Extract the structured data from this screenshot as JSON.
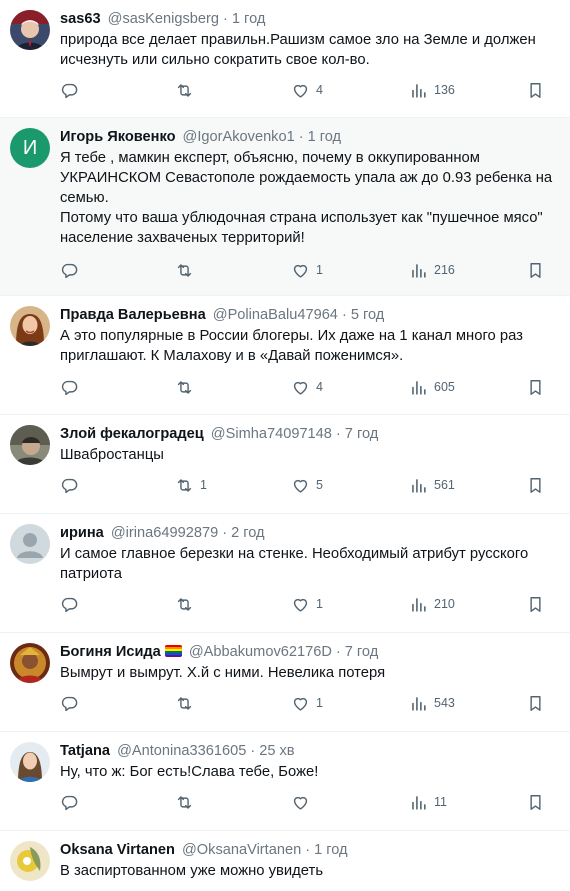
{
  "icons": {
    "reply": "reply-icon",
    "retweet": "retweet-icon",
    "like": "heart-icon",
    "views": "views-icon",
    "bookmark": "bookmark-icon"
  },
  "colors": {
    "icon": "#536471",
    "muted": "#6b7680",
    "highlight_bg": "#f7f9f9",
    "avatar_igor": "#1a9a6c"
  },
  "posts": [
    {
      "name": "sas63",
      "handle": "@sasKenigsberg",
      "time": "1 год",
      "text": "природа все делает правильн.Рашизм самое зло на Земле и должен\nисчезнуть или сильно сократить свое кол-во.",
      "replies": "",
      "retweets": "",
      "likes": "4",
      "views": "136"
    },
    {
      "name": "Игорь Яковенко",
      "handle": "@IgorAkovenko1",
      "time": "1 год",
      "avatar_letter": "И",
      "text": "Я тебе , мамкин експерт, объясню, почему в оккупированном\nУКРАИНСКОМ Севастополе рождаемость упала аж до 0.93 ребенка на\nсемью.\nПотому что ваша ублюдочная страна использует как \"пушечное мясо\"\nнаселение захваченых территорий!",
      "replies": "",
      "retweets": "",
      "likes": "1",
      "views": "216"
    },
    {
      "name": "Правда Валерьевна",
      "handle": "@PolinaBalu47964",
      "time": "5 год",
      "text": "А это популярные в России блогеры. Их даже на 1 канал много раз\nприглашают. К Малахову и в «Давай поженимся».",
      "replies": "",
      "retweets": "",
      "likes": "4",
      "views": "605"
    },
    {
      "name": "Злой фекалоградец",
      "handle": "@Simha74097148",
      "time": "7 год",
      "text": "Швабростанцы",
      "replies": "",
      "retweets": "1",
      "likes": "5",
      "views": "561"
    },
    {
      "name": "ирина",
      "handle": "@irina64992879",
      "time": "2 год",
      "text": "И самое  главное березки на стенке. Необходимый атрибут русского\nпатриота",
      "replies": "",
      "retweets": "",
      "likes": "1",
      "views": "210"
    },
    {
      "name": "Богиня Исида",
      "name_emoji": "rainbow-flag-emoji",
      "handle": "@Abbakumov62176D",
      "time": "7 год",
      "text": "Вымрут и вымрут. Х.й с ними. Невелика потеря",
      "replies": "",
      "retweets": "",
      "likes": "1",
      "views": "543"
    },
    {
      "name": "Tatjana",
      "handle": "@Antonina3361605",
      "time": "25 хв",
      "text": "Ну, что ж: Бог есть!Слава тебе, Боже!",
      "replies": "",
      "retweets": "",
      "likes": "",
      "views": "11"
    },
    {
      "name": "Oksana Virtanen",
      "handle": "@OksanaVirtanen",
      "time": "1 год",
      "text": "В заспиртованном уже можно увидеть",
      "replies": "",
      "retweets": "",
      "likes": "",
      "views": ""
    }
  ]
}
